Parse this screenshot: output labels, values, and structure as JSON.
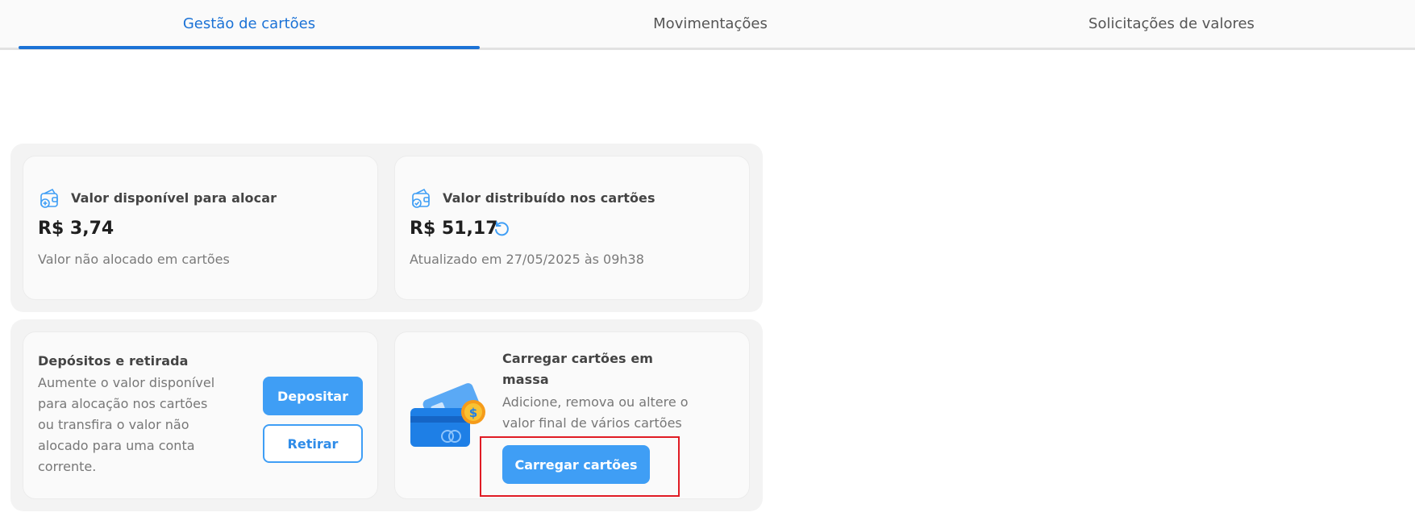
{
  "tabs": [
    {
      "label": "Gestão de cartões",
      "active": true
    },
    {
      "label": "Movimentações",
      "active": false
    },
    {
      "label": "Solicitações de valores",
      "active": false
    }
  ],
  "available": {
    "icon": "wallet-plus-icon",
    "title": "Valor disponível para alocar",
    "amount": "R$ 3,74",
    "subtitle": "Valor não alocado em cartões"
  },
  "distributed": {
    "icon": "wallet-check-icon",
    "title": "Valor distribuído nos cartões",
    "amount": "R$ 51,17",
    "refresh_icon": "refresh-icon",
    "updated": "Atualizado em 27/05/2025 às 09h38"
  },
  "deposits": {
    "title": "Depósitos e retirada",
    "description_lines": [
      "Aumente o valor disponível",
      "para alocação nos cartões",
      "ou transfira o valor não",
      "alocado para uma conta",
      "corrente."
    ],
    "deposit_label": "Depositar",
    "withdraw_label": "Retirar"
  },
  "bulk": {
    "illustration": "cards-coin-illustration",
    "title_lines": [
      "Carregar cartões em",
      "massa"
    ],
    "description_lines": [
      "Adicione, remova ou altere o",
      "valor final de vários cartões"
    ],
    "button_label": "Carregar cartões"
  },
  "colors": {
    "accent": "#1b72d6",
    "button": "#3f9ef5",
    "highlight": "#e01b24"
  }
}
